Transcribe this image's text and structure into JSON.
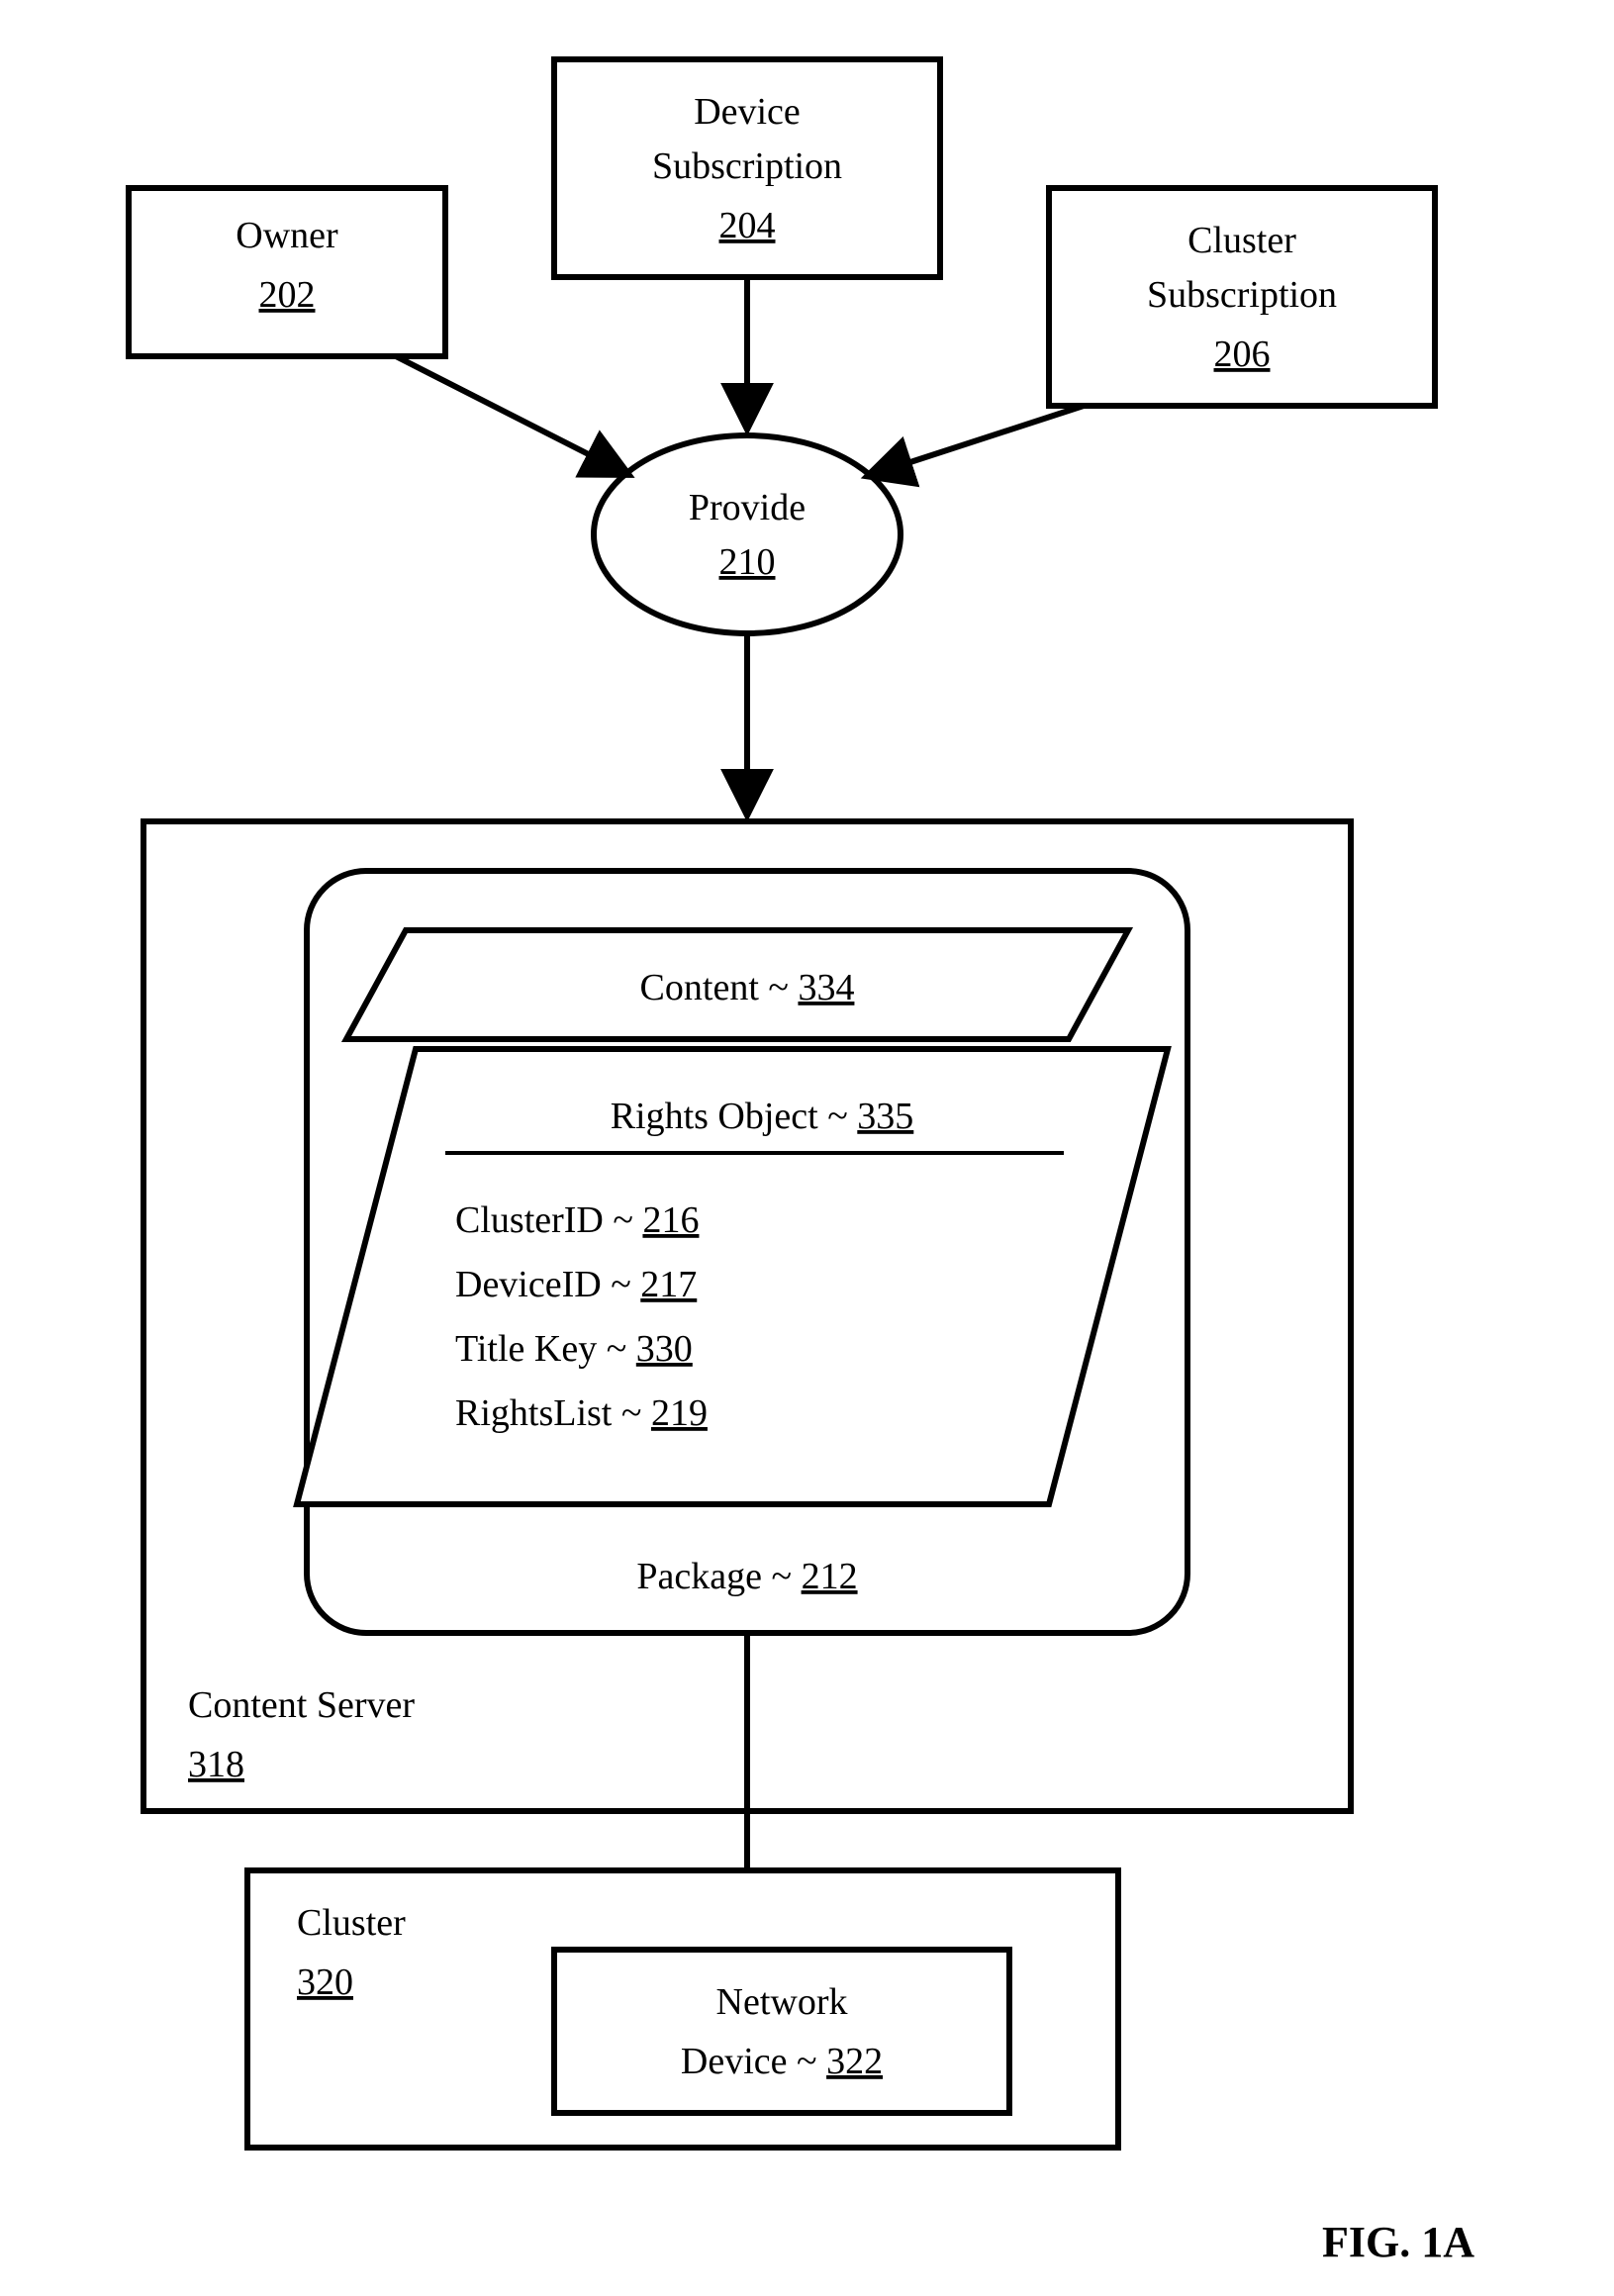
{
  "boxes": {
    "owner": {
      "label": "Owner",
      "ref": "202"
    },
    "device_sub": {
      "label_line1": "Device",
      "label_line2": "Subscription",
      "ref": "204"
    },
    "cluster_sub": {
      "label_line1": "Cluster",
      "label_line2": "Subscription",
      "ref": "206"
    }
  },
  "provide": {
    "label": "Provide",
    "ref": "210"
  },
  "server": {
    "label": "Content Server",
    "ref": "318"
  },
  "package": {
    "label": "Package",
    "ref": "212"
  },
  "content": {
    "label": "Content",
    "ref": "334"
  },
  "rights_object": {
    "label": "Rights Object",
    "ref": "335"
  },
  "rights_fields": [
    {
      "label": "ClusterID",
      "ref": "216"
    },
    {
      "label": "DeviceID",
      "ref": "217"
    },
    {
      "label": "Title Key",
      "ref": "330"
    },
    {
      "label": "RightsList",
      "ref": "219"
    }
  ],
  "cluster": {
    "label": "Cluster",
    "ref": "320"
  },
  "network_device": {
    "label_line1": "Network",
    "label_line2": "Device",
    "ref": "322"
  },
  "figure": "FIG. 1A"
}
